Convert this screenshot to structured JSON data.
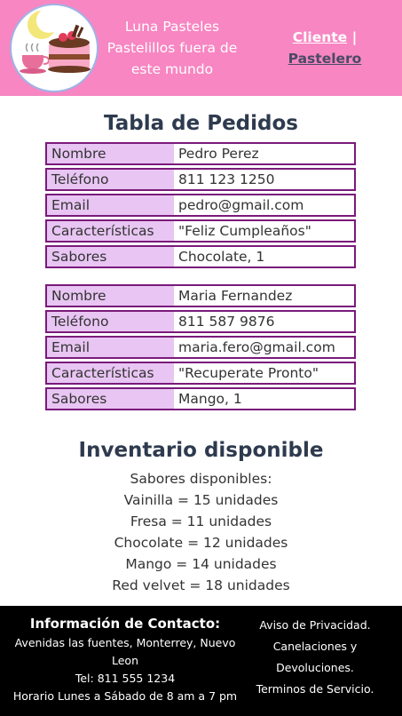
{
  "header": {
    "brand_line1": "Luna Pasteles",
    "brand_line2": "Pastelillos fuera de este mundo",
    "nav_cliente": "Cliente",
    "nav_separator": "|",
    "nav_pastelero": "Pastelero"
  },
  "orders": {
    "title": "Tabla de Pedidos",
    "list": [
      {
        "rows": [
          {
            "label": "Nombre",
            "value": "Pedro Perez"
          },
          {
            "label": "Teléfono",
            "value": "811 123 1250"
          },
          {
            "label": "Email",
            "value": "pedro@gmail.com"
          },
          {
            "label": "Características",
            "value": "\"Feliz Cumpleaños\""
          },
          {
            "label": "Sabores",
            "value": "Chocolate, 1"
          }
        ]
      },
      {
        "rows": [
          {
            "label": "Nombre",
            "value": "Maria Fernandez"
          },
          {
            "label": "Teléfono",
            "value": "811 587 9876"
          },
          {
            "label": "Email",
            "value": "maria.fero@gmail.com"
          },
          {
            "label": "Características",
            "value": "\"Recuperate Pronto\""
          },
          {
            "label": "Sabores",
            "value": "Mango, 1"
          }
        ]
      }
    ]
  },
  "inventory": {
    "title": "Inventario disponible",
    "subtitle": "Sabores disponibles:",
    "items": [
      "Vainilla = 15 unidades",
      "Fresa = 11 unidades",
      "Chocolate = 12 unidades",
      "Mango = 14 unidades",
      "Red velvet = 18 unidades"
    ]
  },
  "footer": {
    "contact_title": "Información de Contacto:",
    "address": "Avenidas las fuentes, Monterrey, Nuevo Leon",
    "phone": "Tel: 811 555 1234",
    "hours": "Horario Lunes a Sábado de 8 am a 7 pm",
    "privacy": "Aviso de Privacidad.",
    "cancellations": "Canelaciones y Devoluciones.",
    "terms": "Terminos de Servicio."
  },
  "colors": {
    "header_bg": "#f786c2",
    "table_label_bg": "#e8c5f3",
    "table_border": "#7a1a7a",
    "title_color": "#2e3a4e",
    "footer_bg": "#000000"
  },
  "icons": {
    "logo": "cake-moon-logo-icon"
  }
}
